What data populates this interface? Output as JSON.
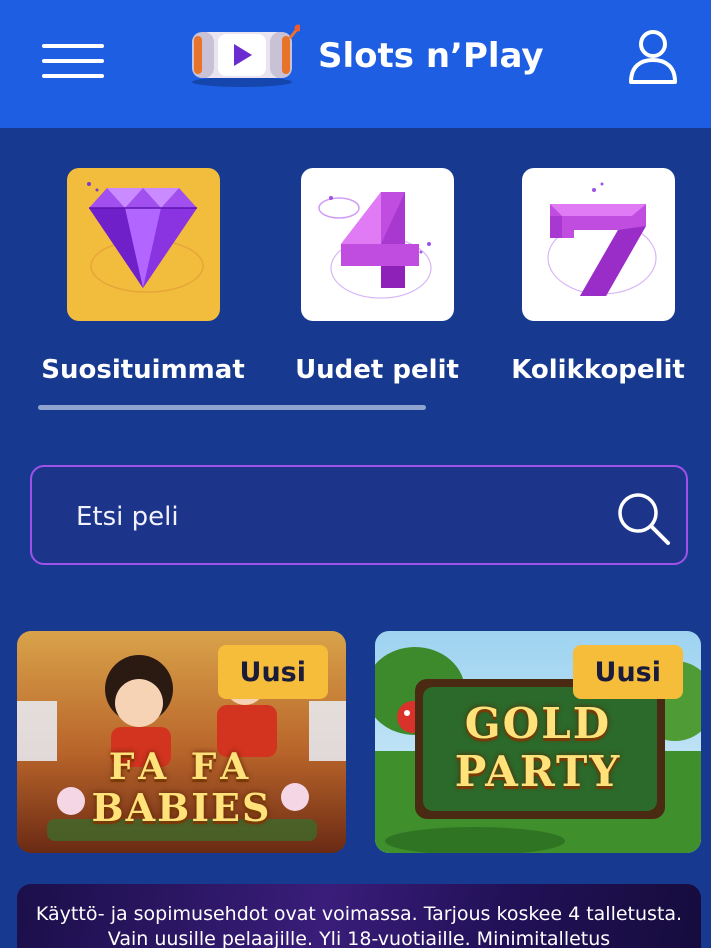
{
  "header": {
    "brand": "Slots n’Play",
    "menu_icon": "hamburger-menu-icon",
    "user_icon": "user-icon",
    "colors": {
      "header_bg": "#1d5ee3",
      "page_bg": "#17398f"
    }
  },
  "categories": [
    {
      "label": "Suosituimmat",
      "icon": "diamond-icon",
      "tile_color": "#f2bd3c"
    },
    {
      "label": "Uudet pelit",
      "icon": "four-icon",
      "tile_color": "#ffffff"
    },
    {
      "label": "Kolikkopelit",
      "icon": "seven-icon",
      "tile_color": "#ffffff"
    }
  ],
  "search": {
    "placeholder": "Etsi peli",
    "icon": "search-icon",
    "border_color": "#9f52e8"
  },
  "games": [
    {
      "title_line1": "FA FA",
      "title_line2": "BABIES",
      "badge": "Uusi"
    },
    {
      "title_line1": "GOLD",
      "title_line2": "PARTY",
      "badge": "Uusi"
    }
  ],
  "badge_color": "#f5bd3a",
  "promo": {
    "text": "Käyttö- ja sopimusehdot ovat voimassa. Tarjous koskee 4 talletusta. Vain uusille pelaajille. Yli 18-vuotiaille. Minimitalletus"
  }
}
